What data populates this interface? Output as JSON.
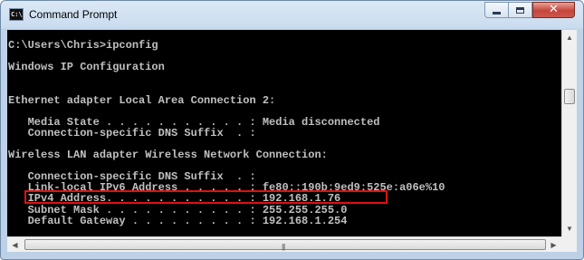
{
  "window": {
    "title": "Command Prompt",
    "icon_label": "C:\\",
    "controls": {
      "minimize_icon": "minimize-icon",
      "maximize_icon": "maximize-icon",
      "close_icon": "close-icon",
      "close_glyph": "✕"
    }
  },
  "console": {
    "text_color": "#c0c0c0",
    "background": "#000000",
    "highlight_color": "#e01010",
    "lines": [
      "C:\\Users\\Chris>ipconfig",
      "",
      "Windows IP Configuration",
      "",
      "",
      "Ethernet adapter Local Area Connection 2:",
      "",
      "   Media State . . . . . . . . . . . : Media disconnected",
      "   Connection-specific DNS Suffix  . :",
      "",
      "Wireless LAN adapter Wireless Network Connection:",
      "",
      "   Connection-specific DNS Suffix  . :",
      "   Link-local IPv6 Address . . . . . : fe80::190b:9ed9:525e:a06e%10",
      "   IPv4 Address. . . . . . . . . . . : 192.168.1.76",
      "   Subnet Mask . . . . . . . . . . . : 255.255.255.0",
      "   Default Gateway . . . . . . . . . : 192.168.1.254"
    ]
  },
  "scrollbars": {
    "up_arrow": "▲",
    "down_arrow": "▼",
    "left_arrow": "◀",
    "right_arrow": "▶",
    "grip": "|||"
  }
}
